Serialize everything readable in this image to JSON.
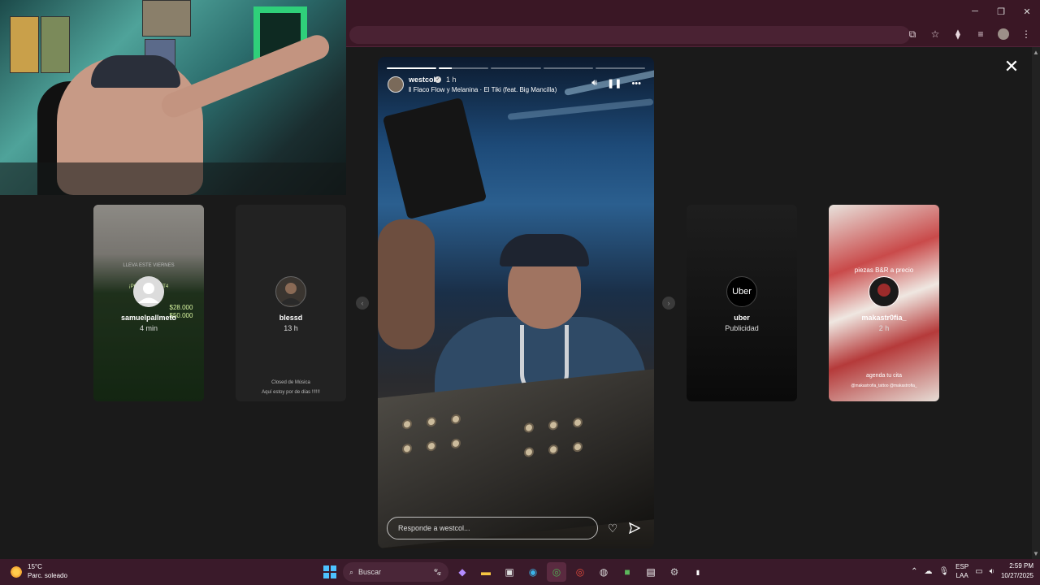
{
  "colors": {
    "titlebar": "#3a1725",
    "taskbar": "#3a1a2a",
    "viewport": "#1a1a1a"
  },
  "story": {
    "username": "westcol",
    "time": "1 h",
    "music": "Flaco Flow y Melanina · El Tiki (feat. Big Mancilla)",
    "reply_placeholder": "Responde a westcol...",
    "progress_fractions": [
      1,
      0.25,
      0,
      0,
      0
    ]
  },
  "cards": [
    {
      "name": "samuelpallmeto",
      "time": "4 min",
      "text_lines": [
        "LLEVA ESTE VIERNES",
        "¡POR EL VOLET4",
        "$28.000",
        "$50.000"
      ]
    },
    {
      "name": "blessd",
      "time": "13 h",
      "text_lines": [
        "Closed de Música",
        "Aquí estoy por de días !!!!!!"
      ]
    },
    {
      "name": "uber",
      "time": "Publicidad",
      "logo": "Uber"
    },
    {
      "name": "makastr0fia_",
      "time": "2 h",
      "text_lines": [
        "piezas B&R a precio",
        "agenda tu cita",
        "@makastrofia_tattoo @makastrofia_"
      ]
    }
  ],
  "taskbar": {
    "weather_temp": "15°C",
    "weather_desc": "Parc. soleado",
    "search_label": "Buscar",
    "lang_top": "ESP",
    "lang_bottom": "LAA",
    "time": "2:59 PM",
    "date": "10/27/2025"
  },
  "icons": {
    "minimize": "minimize-icon",
    "restore": "restore-icon",
    "close": "close-icon",
    "mute": "speaker-icon",
    "pause": "pause-icon",
    "more": "more-icon",
    "heart": "heart-icon",
    "send": "send-icon"
  }
}
